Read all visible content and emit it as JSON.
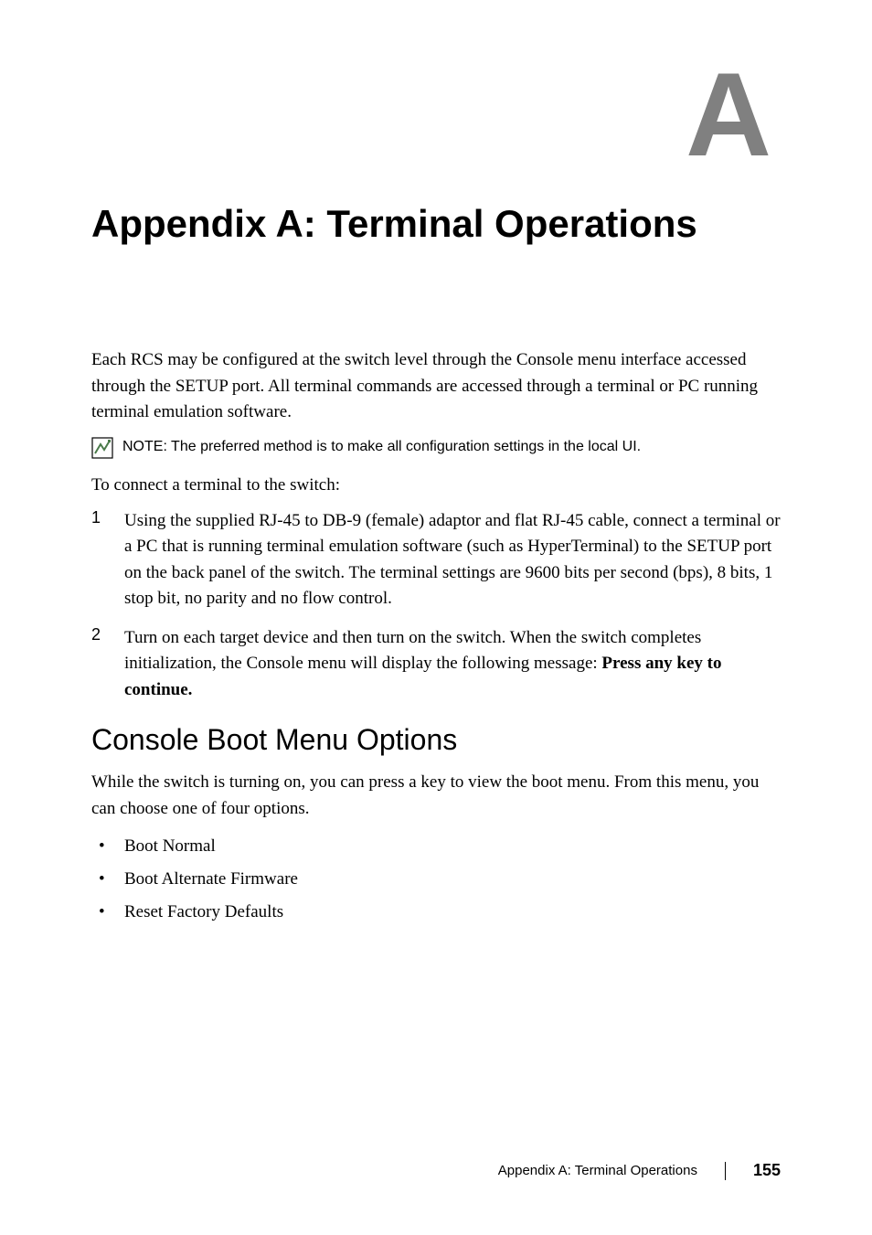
{
  "appendix_letter": "A",
  "main_title": "Appendix A: Terminal Operations",
  "intro": "Each RCS may be configured at the switch level through the Console menu interface accessed through the SETUP port. All terminal commands are accessed through a terminal or PC running terminal emulation software.",
  "note": "NOTE: The preferred method is to make all configuration settings in the local UI.",
  "connect_intro": "To connect a terminal to the switch:",
  "steps": [
    {
      "number": "1",
      "text": "Using the supplied RJ-45 to DB-9 (female) adaptor and flat RJ-45 cable, connect a terminal or a PC that is running terminal emulation software (such as HyperTerminal) to the SETUP port on the back panel of the switch. The terminal settings are 9600 bits per second (bps), 8 bits, 1 stop bit, no parity and no flow control."
    },
    {
      "number": "2",
      "text_prefix": "Turn on each target device and then turn on the switch. When the switch completes initialization, the Console menu will display the following message: ",
      "text_bold": "Press any key to continue."
    }
  ],
  "section_heading": "Console Boot Menu Options",
  "section_text": "While the switch is turning on, you can press a key to view the boot menu. From this menu, you can choose one of four options.",
  "bullets": [
    "Boot Normal",
    "Boot Alternate Firmware",
    "Reset Factory Defaults"
  ],
  "footer_text": "Appendix A: Terminal Operations",
  "page_number": "155"
}
